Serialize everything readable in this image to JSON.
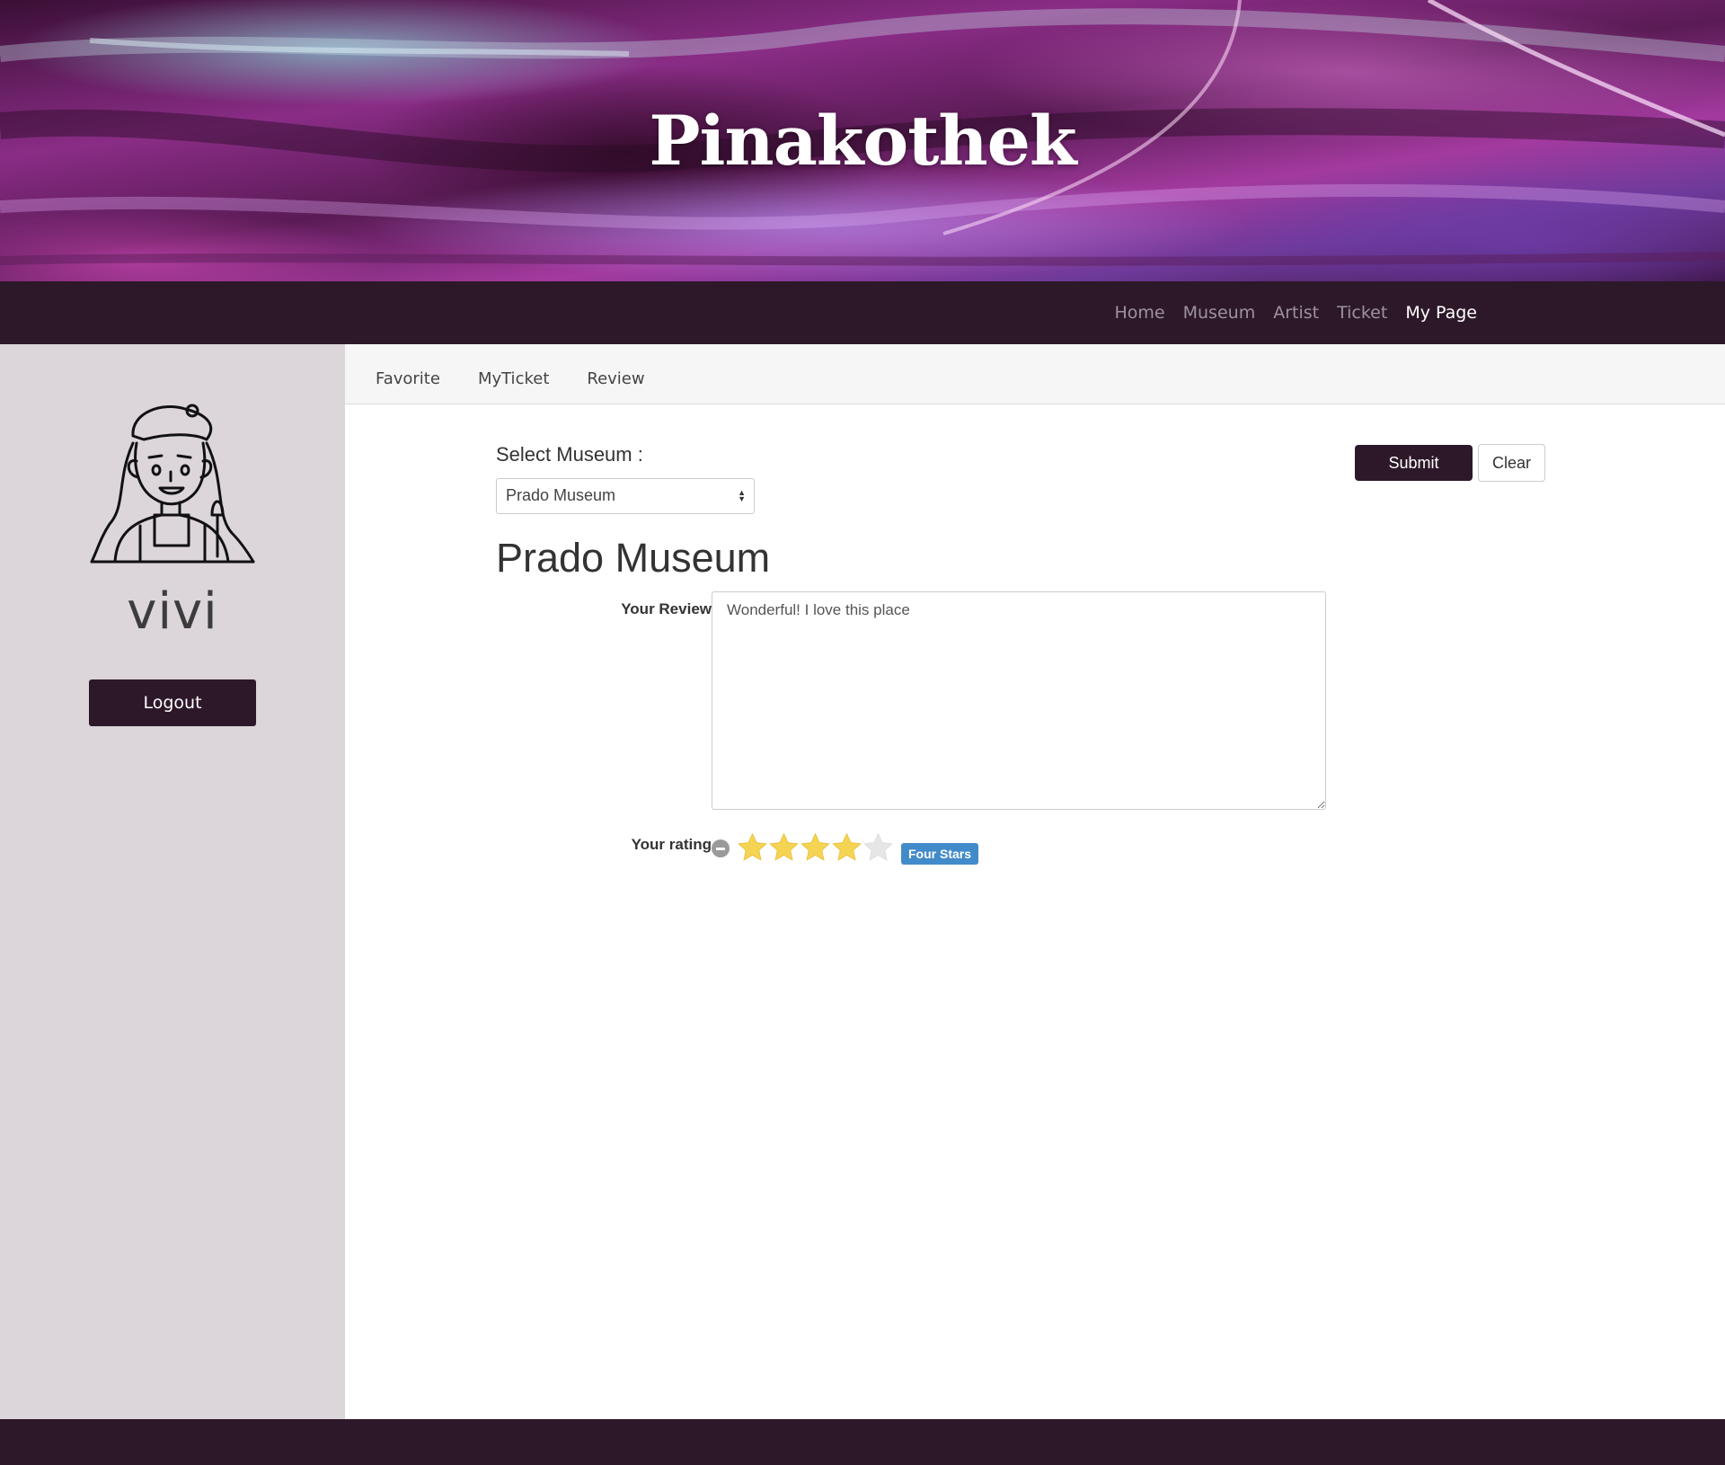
{
  "site": {
    "title": "Pinakothek"
  },
  "nav": {
    "items": [
      {
        "label": "Home",
        "active": false
      },
      {
        "label": "Museum",
        "active": false
      },
      {
        "label": "Artist",
        "active": false
      },
      {
        "label": "Ticket",
        "active": false
      },
      {
        "label": "My Page",
        "active": true
      }
    ]
  },
  "sidebar": {
    "avatar_icon": "artist-avatar-icon",
    "username": "vivi",
    "logout_label": "Logout"
  },
  "subtabs": [
    {
      "label": "Favorite"
    },
    {
      "label": "MyTicket"
    },
    {
      "label": "Review"
    }
  ],
  "form": {
    "select_label": "Select Museum :",
    "selected_museum": "Prado Museum",
    "heading": "Prado Museum",
    "submit_label": "Submit",
    "clear_label": "Clear",
    "review_label": "Your Review",
    "review_text": "Wonderful! I love this place",
    "rating_label": "Your rating",
    "rating_value": 4,
    "rating_max": 5,
    "rating_caption": "Four Stars"
  },
  "colors": {
    "brand_dark": "#2d1829",
    "sidebar_bg": "#dcd5da",
    "star_filled": "#f5d454",
    "star_empty": "#e6e6e6",
    "badge": "#428bca"
  }
}
